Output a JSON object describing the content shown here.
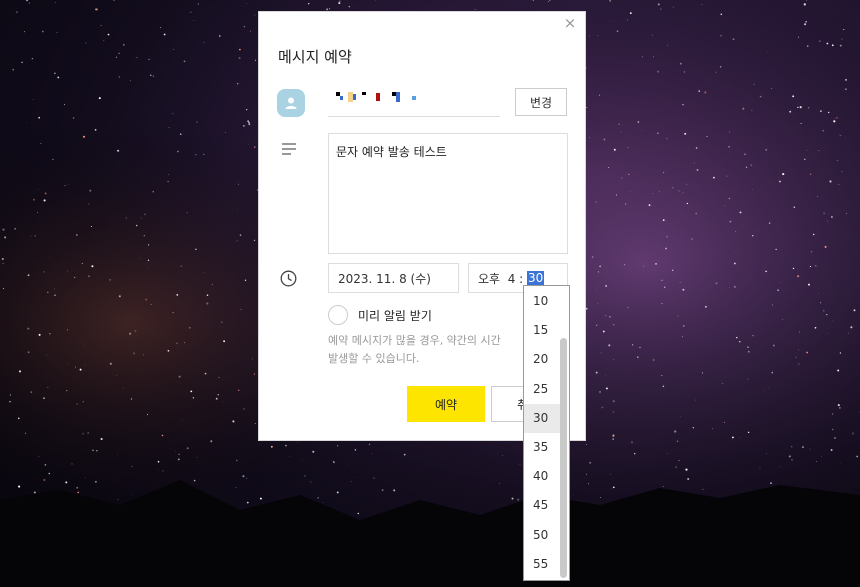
{
  "modal": {
    "title": "메시지 예약",
    "close_glyph": "×",
    "change_button": "변경",
    "message_text": "문자 예약 발송 테스트",
    "date_value": "2023. 11. 8 (수)",
    "time_prefix": "오후  4 : ",
    "time_selected": "30",
    "reminder_label": "미리 알림 받기",
    "notice_line1": "예약 메시지가 많을 경우, 약간의 시간",
    "notice_line2": "발생할 수 있습니다.",
    "reserve_button": "예약",
    "cancel_button": "취"
  },
  "minute_options": [
    "10",
    "15",
    "20",
    "25",
    "30",
    "35",
    "40",
    "45",
    "50",
    "55"
  ],
  "selected_minute": "30",
  "icons": {
    "close": "close-icon",
    "avatar": "person-icon",
    "message": "text-lines-icon",
    "time": "clock-icon"
  },
  "colors": {
    "accent": "#fee500",
    "avatar_bg": "#a9d3e3",
    "selection": "#3b73d6"
  }
}
